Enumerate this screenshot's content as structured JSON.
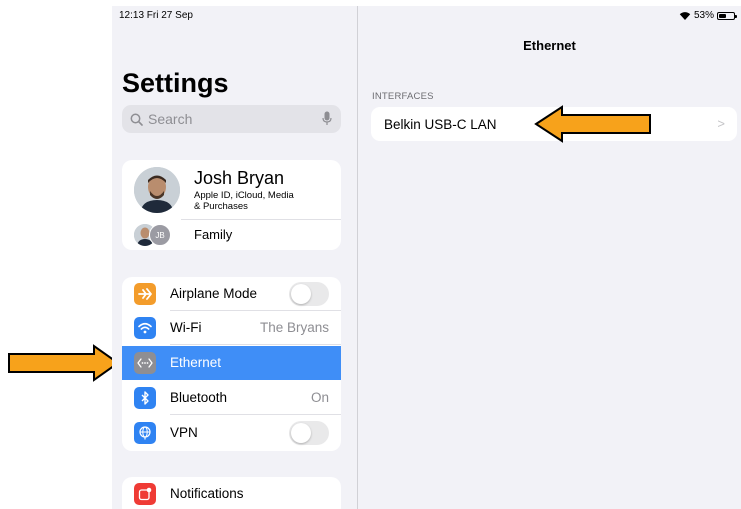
{
  "status_bar": {
    "time": "12:13 Fri 27 Sep",
    "battery": "53%",
    "battery_level": 0.53
  },
  "sidebar": {
    "title": "Settings",
    "search_placeholder": "Search",
    "profile": {
      "name": "Josh Bryan",
      "subtitle_line1": "Apple ID, iCloud, Media",
      "subtitle_line2": "& Purchases",
      "family_label": "Family",
      "family_initials": "JB"
    },
    "items": [
      {
        "label": "Airplane Mode",
        "value": "",
        "icon": "airplane-icon",
        "icon_color": "#f39c2b",
        "toggle": true
      },
      {
        "label": "Wi-Fi",
        "value": "The Bryans",
        "icon": "wifi-icon",
        "icon_color": "#2f83f2",
        "toggle": false
      },
      {
        "label": "Ethernet",
        "value": "",
        "icon": "ethernet-icon",
        "icon_color": "#8e8e93",
        "toggle": false,
        "selected": true
      },
      {
        "label": "Bluetooth",
        "value": "On",
        "icon": "bluetooth-icon",
        "icon_color": "#2f83f2",
        "toggle": false
      },
      {
        "label": "VPN",
        "value": "",
        "icon": "vpn-globe-icon",
        "icon_color": "#2f83f2",
        "toggle": true
      }
    ],
    "notifications_label": "Notifications"
  },
  "detail": {
    "title": "Ethernet",
    "section_header": "INTERFACES",
    "interface_label": "Belkin USB-C LAN",
    "chevron": ">"
  },
  "colors": {
    "selected_row": "#3f8ef7",
    "annotation_arrow_fill": "#f7a21b",
    "annotation_arrow_stroke": "#000000"
  }
}
